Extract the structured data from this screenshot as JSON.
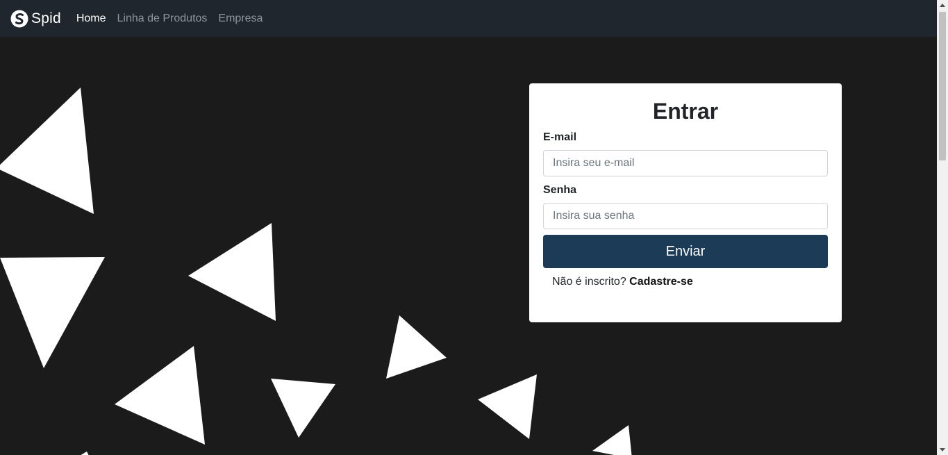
{
  "navbar": {
    "brand": "Spid",
    "links": [
      {
        "label": "Home",
        "active": true
      },
      {
        "label": "Linha de Produtos",
        "active": false
      },
      {
        "label": "Empresa",
        "active": false
      }
    ]
  },
  "login": {
    "title": "Entrar",
    "email_label": "E-mail",
    "email_placeholder": "Insira seu e-mail",
    "email_value": "",
    "password_label": "Senha",
    "password_placeholder": "Insira sua senha",
    "password_value": "",
    "submit_label": "Enviar",
    "signup_prompt": "Não é inscrito?",
    "signup_link": "Cadastre-se"
  },
  "colors": {
    "navbar_bg": "#1f262d",
    "page_bg": "#1b1b1b",
    "button_bg": "#1b3b57",
    "triangle_fill": "#ffffff"
  }
}
